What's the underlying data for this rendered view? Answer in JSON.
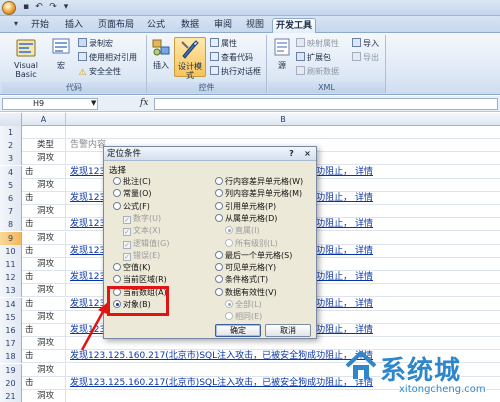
{
  "ribbon_tabs": [
    "开始",
    "插入",
    "页面布局",
    "公式",
    "数据",
    "审阅",
    "视图",
    "开发工具"
  ],
  "active_tab": "开发工具",
  "ribbon": {
    "code": {
      "label": "代码",
      "visual_basic": "Visual Basic",
      "macros": "宏",
      "record_macro": "录制宏",
      "relative_ref": "使用相对引用",
      "macro_security": "安全全性"
    },
    "controls": {
      "label": "控件",
      "insert": "插入",
      "design_mode": "设计模式",
      "properties": "属性",
      "view_code": "查看代码",
      "run_dialog": "执行对话框"
    },
    "source": "源",
    "xml": {
      "label": "XML",
      "map_properties": "映射属性",
      "expansion_packs": "扩展包",
      "refresh_data": "刷新数据",
      "import": "导入",
      "export": "导出"
    }
  },
  "formula_bar": {
    "name_box": "H9",
    "fx": "fx",
    "formula": ""
  },
  "columns": [
    "A",
    "B"
  ],
  "rows": [
    {
      "n": "1",
      "a": "",
      "b": ""
    },
    {
      "n": "2",
      "a": "类型",
      "b": "告警内容"
    },
    {
      "n": "3",
      "a": "洞攻",
      "b": ""
    },
    {
      "n": "4",
      "a": "",
      "b": "发现123.125.160.217(北京市)SQL注入攻击，已被安全狗成功阻止，  详情"
    },
    {
      "n": "5",
      "a": "洞攻",
      "b": ""
    },
    {
      "n": "6",
      "a": "",
      "b": "发现123.125.160.217(北京市)SQL注入攻击，已被安全狗成功阻止，  详情"
    },
    {
      "n": "7",
      "a": "洞攻",
      "b": ""
    },
    {
      "n": "8",
      "a": "",
      "b": "发现123.125.160.217(北京市)SQL注入攻击，已被安全狗成功阻止，  详情"
    },
    {
      "n": "9",
      "a": "洞攻",
      "b": ""
    },
    {
      "n": "10",
      "a": "",
      "b": "发现123.125.160.217(北京市)SQL注入攻击，已被安全狗成功阻止，  详情"
    },
    {
      "n": "11",
      "a": "洞攻",
      "b": ""
    },
    {
      "n": "12",
      "a": "",
      "b": "发现123.125.160.217(北京市)SQL注入攻击，已被安全狗成功阻止，  详情"
    },
    {
      "n": "13",
      "a": "洞攻",
      "b": ""
    },
    {
      "n": "14",
      "a": "",
      "b": "发现123.125.160.217(北京市)SQL注入攻击，已被安全狗成功阻止，  详情"
    },
    {
      "n": "15",
      "a": "洞攻",
      "b": ""
    },
    {
      "n": "16",
      "a": "",
      "b": "发现123.125.160.217(北京市)SQL注入攻击，已被安全狗成功阻止，  详情"
    },
    {
      "n": "17",
      "a": "洞攻",
      "b": ""
    },
    {
      "n": "18",
      "a": "",
      "b": "发现123.125.160.217(北京市)SQL注入攻击，已被安全狗成功阻止，  详情"
    },
    {
      "n": "19",
      "a": "洞攻",
      "b": ""
    },
    {
      "n": "20",
      "a": "",
      "b": "发现123.125.160.217(北京市)SQL注入攻击，已被安全狗成功阻止，  详情"
    },
    {
      "n": "21",
      "a": "洞攻",
      "b": ""
    }
  ],
  "row_suffix": "击",
  "dialog": {
    "title": "定位条件",
    "help": "?",
    "close": "×",
    "section": "选择",
    "left_options": [
      "批注(C)",
      "常量(O)",
      "公式(F)"
    ],
    "formula_sub": [
      "数字(U)",
      "文本(X)",
      "逻辑值(G)",
      "错误(E)"
    ],
    "left_options2": [
      "空值(K)",
      "当前区域(R)",
      "当前数组(A)",
      "对象(B)"
    ],
    "right_options": [
      "行内容差异单元格(W)",
      "列内容差异单元格(M)",
      "引用单元格(P)",
      "从属单元格(D)"
    ],
    "dependents_sub": [
      "直属(I)",
      "所有级别(L)"
    ],
    "right_options2": [
      "最后一个单元格(S)",
      "可见单元格(Y)",
      "条件格式(T)",
      "数据有效性(V)"
    ],
    "validation_sub": [
      "全部(L)",
      "相同(E)"
    ],
    "selected": "对象(B)",
    "ok": "确定",
    "cancel": "取消"
  },
  "watermark": {
    "text": "系统城",
    "url": "xitongcheng.com"
  }
}
